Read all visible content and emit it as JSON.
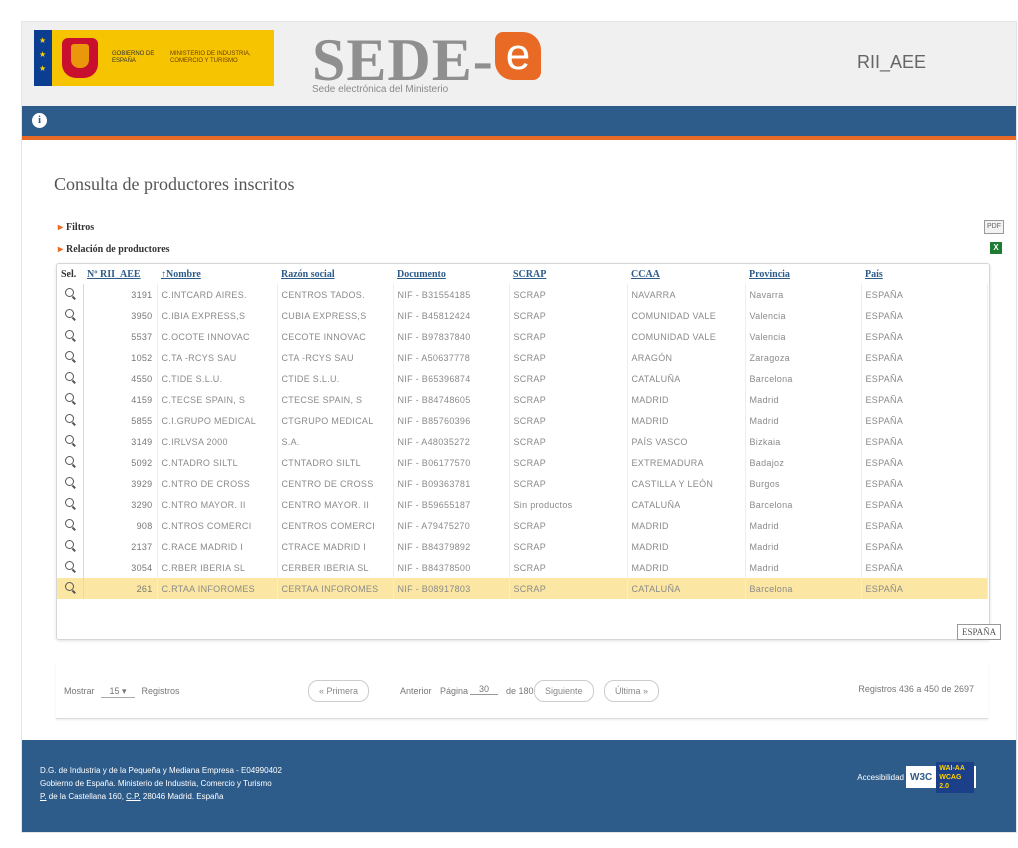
{
  "header": {
    "gov_line": "GOBIERNO DE ESPAÑA",
    "ministry_line": "MINISTERIO DE INDUSTRIA, COMERCIO Y TURISMO",
    "brand": "SEDE-",
    "brand_e": "e",
    "subtitle": "Sede electrónica del Ministerio",
    "app_code": "RII_AEE",
    "colors": {
      "nav": "#2e5c8a",
      "accent": "#e96a24",
      "brand_yellow": "#f6c400"
    }
  },
  "main": {
    "title": "Consulta de productores inscritos",
    "filters_label": "Filtros",
    "relation_label": "Relación de productores",
    "pdf_icon": "pdf-icon",
    "excel_icon": "excel-icon"
  },
  "table": {
    "headers": [
      "Sel.",
      "Nº RII_AEE",
      "↑Nombre",
      "Razón social",
      "Documento",
      "SCRAP",
      "CCAA",
      "Provincia",
      "País"
    ],
    "rows": [
      [
        "3191",
        "C.INTCARD AIRES.",
        "CENTROS TADOS.",
        "NIF - B31554185",
        "SCRAP",
        "NAVARRA",
        "Navarra",
        "ESPAÑA"
      ],
      [
        "3950",
        "C.IBIA EXPRESS,S",
        "CUBIA EXPRESS,S",
        "NIF - B45812424",
        "SCRAP",
        "COMUNIDAD VALE",
        "Valencia",
        "ESPAÑA"
      ],
      [
        "5537",
        "C.OCOTE INNOVAC",
        "CECOTE INNOVAC",
        "NIF - B97837840",
        "SCRAP",
        "COMUNIDAD VALE",
        "Valencia",
        "ESPAÑA"
      ],
      [
        "1052",
        "C.TA -RCYS SAU",
        "CTA -RCYS SAU",
        "NIF - A50637778",
        "SCRAP",
        "ARAGÓN",
        "Zaragoza",
        "ESPAÑA"
      ],
      [
        "4550",
        "C.TIDE S.L.U.",
        "CTIDE S.L.U.",
        "NIF - B65396874",
        "SCRAP",
        "CATALUÑA",
        "Barcelona",
        "ESPAÑA"
      ],
      [
        "4159",
        "C.TECSE SPAIN, S",
        "CTECSE SPAIN, S",
        "NIF - B84748605",
        "SCRAP",
        "MADRID",
        "Madrid",
        "ESPAÑA"
      ],
      [
        "5855",
        "C.I.GRUPO MEDICAL",
        "CTGRUPO MEDICAL",
        "NIF - B85760396",
        "SCRAP",
        "MADRID",
        "Madrid",
        "ESPAÑA"
      ],
      [
        "3149",
        "C.IRLVSA 2000",
        "S.A.",
        "NIF - A48035272",
        "SCRAP",
        "PAÍS VASCO",
        "Bizkaia",
        "ESPAÑA"
      ],
      [
        "5092",
        "C.NTADRO SILTL",
        "CTNTADRO SILTL",
        "NIF - B06177570",
        "SCRAP",
        "EXTREMADURA",
        "Badajoz",
        "ESPAÑA"
      ],
      [
        "3929",
        "C.NTRO DE CROSS",
        "CENTRO DE CROSS",
        "NIF - B09363781",
        "SCRAP",
        "CASTILLA Y LEÓN",
        "Burgos",
        "ESPAÑA"
      ],
      [
        "3290",
        "C.NTRO MAYOR. II",
        "CENTRO MAYOR. II",
        "NIF - B59655187",
        "Sin productos",
        "CATALUÑA",
        "Barcelona",
        "ESPAÑA"
      ],
      [
        "908",
        "C.NTROS COMERCI",
        "CENTROS COMERCI",
        "NIF - A79475270",
        "SCRAP",
        "MADRID",
        "Madrid",
        "ESPAÑA"
      ],
      [
        "2137",
        "C.RACE MADRID I",
        "CTRACE MADRID I",
        "NIF - B84379892",
        "SCRAP",
        "MADRID",
        "Madrid",
        "ESPAÑA"
      ],
      [
        "3054",
        "C.RBER IBERIA SL",
        "CERBER IBERIA SL",
        "NIF - B84378500",
        "SCRAP",
        "MADRID",
        "Madrid",
        "ESPAÑA"
      ],
      [
        "261",
        "C.RTAA INFOROMES",
        "CERTAA INFOROMES",
        "NIF - B08917803",
        "SCRAP",
        "CATALUÑA",
        "Barcelona",
        "ESPAÑA"
      ]
    ],
    "highlighted_row": 14,
    "highlight_color": "#fbe7a3",
    "tooltip": "ESPAÑA"
  },
  "pager": {
    "show_label": "Mostrar",
    "per_page": "15",
    "records_label": "Registros",
    "first": "« Primera",
    "prev": "Anterior",
    "page_label": "Página",
    "page_value": "30",
    "of_label": "de 180",
    "next": "Siguiente",
    "last": "Última »",
    "summary": "Registros 436 a 450 de 2697"
  },
  "footer": {
    "line1": "D.G. de Industria y de la Pequeña y Mediana Empresa - E04990402",
    "line2": "Gobierno de España. Ministerio de Industria, Comercio y Turismo",
    "line3_prefix": "P.",
    "line3_a": " de la Castellana 160, ",
    "line3_cp": "C.P.",
    "line3_b": " 28046 Madrid. España",
    "accessibility": "Accesibilidad",
    "w3c": "W3C",
    "wai_1": "WAI-AA",
    "wai_2": "WCAG 2.0"
  }
}
